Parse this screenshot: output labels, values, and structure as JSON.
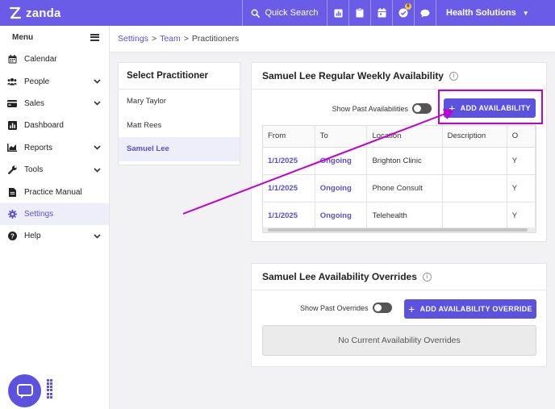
{
  "app": {
    "logo_text": "zanda",
    "brand_color": "#6b5ce7"
  },
  "topbar": {
    "search_label": "Quick Search",
    "icons": [
      "chart-icon",
      "clipboard-icon",
      "calendar-icon",
      "tasks-icon",
      "chat-icon"
    ],
    "tasks_badge": "6",
    "org_name": "Health Solutions"
  },
  "sidebar": {
    "menu_label": "Menu",
    "items": [
      {
        "label": "Calendar",
        "icon": "calendar-icon",
        "expandable": false
      },
      {
        "label": "People",
        "icon": "people-icon",
        "expandable": true
      },
      {
        "label": "Sales",
        "icon": "sales-icon",
        "expandable": true
      },
      {
        "label": "Dashboard",
        "icon": "dashboard-icon",
        "expandable": false
      },
      {
        "label": "Reports",
        "icon": "reports-icon",
        "expandable": true
      },
      {
        "label": "Tools",
        "icon": "wrench-icon",
        "expandable": true
      },
      {
        "label": "Practice Manual",
        "icon": "document-icon",
        "expandable": false
      },
      {
        "label": "Settings",
        "icon": "gear-icon",
        "expandable": false,
        "active": true
      },
      {
        "label": "Help",
        "icon": "help-icon",
        "expandable": true
      }
    ]
  },
  "breadcrumb": {
    "settings": "Settings",
    "team": "Team",
    "current": "Practitioners",
    "sep": ">"
  },
  "practitioners": {
    "title": "Select Practitioner",
    "items": [
      "Mary Taylor",
      "Matt Rees",
      "Samuel Lee"
    ],
    "selected_index": 2
  },
  "availability": {
    "title": "Samuel Lee Regular Weekly Availability",
    "show_past_label": "Show Past Availabilities",
    "add_button": "ADD AVAILABILITY",
    "columns": [
      "From",
      "To",
      "Location",
      "Description",
      "O"
    ],
    "rows": [
      {
        "from": "1/1/2025",
        "to": "Ongoing",
        "location": "Brighton Clinic",
        "description": "",
        "extra": "Y"
      },
      {
        "from": "1/1/2025",
        "to": "Ongoing",
        "location": "Phone Consult",
        "description": "",
        "extra": "Y"
      },
      {
        "from": "1/1/2025",
        "to": "Ongoing",
        "location": "Telehealth",
        "description": "",
        "extra": "Y"
      }
    ]
  },
  "overrides": {
    "title": "Samuel Lee Availability Overrides",
    "show_past_label": "Show Past Overrides",
    "add_button": "ADD AVAILABILITY OVERRIDE",
    "empty_text": "No Current Availability Overrides"
  },
  "annotation": {
    "color": "#c000d0"
  }
}
